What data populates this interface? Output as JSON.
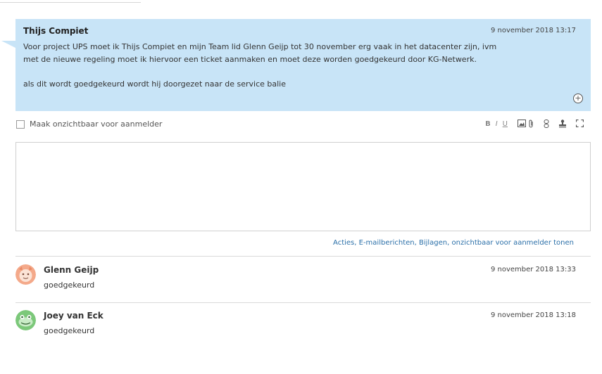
{
  "request": {
    "author": "Thijs Compiet",
    "date": "9 november 2018 13:17",
    "line1": "Voor project UPS moet ik Thijs Compiet en mijn Team lid Glenn Geijp tot 30 november erg vaak in het datacenter zijn, ivm",
    "line2": "met de nieuwe regeling moet ik hiervoor een ticket aanmaken en moet deze worden goedgekeurd door KG-Netwerk.",
    "line3": "als dit wordt goedgekeurd wordt hij doorgezet naar de service balie"
  },
  "editor": {
    "hide_label": "Maak onzichtbaar voor aanmelder",
    "tools": {
      "bold": "B",
      "italic": "I",
      "underline": "U"
    }
  },
  "filters_link": "Acties, E-mailberichten, Bijlagen, onzichtbaar voor aanmelder tonen",
  "replies": [
    {
      "name": "Glenn Geijp",
      "date": "9 november 2018 13:33",
      "text": "goedgekeurd",
      "avatar_color": "#f4a98a"
    },
    {
      "name": "Joey van Eck",
      "date": "9 november 2018 13:18",
      "text": "goedgekeurd",
      "avatar_color": "#7cc87a"
    }
  ],
  "colors": {
    "request_bg": "#c8e4f7",
    "link": "#2a6fa8"
  }
}
